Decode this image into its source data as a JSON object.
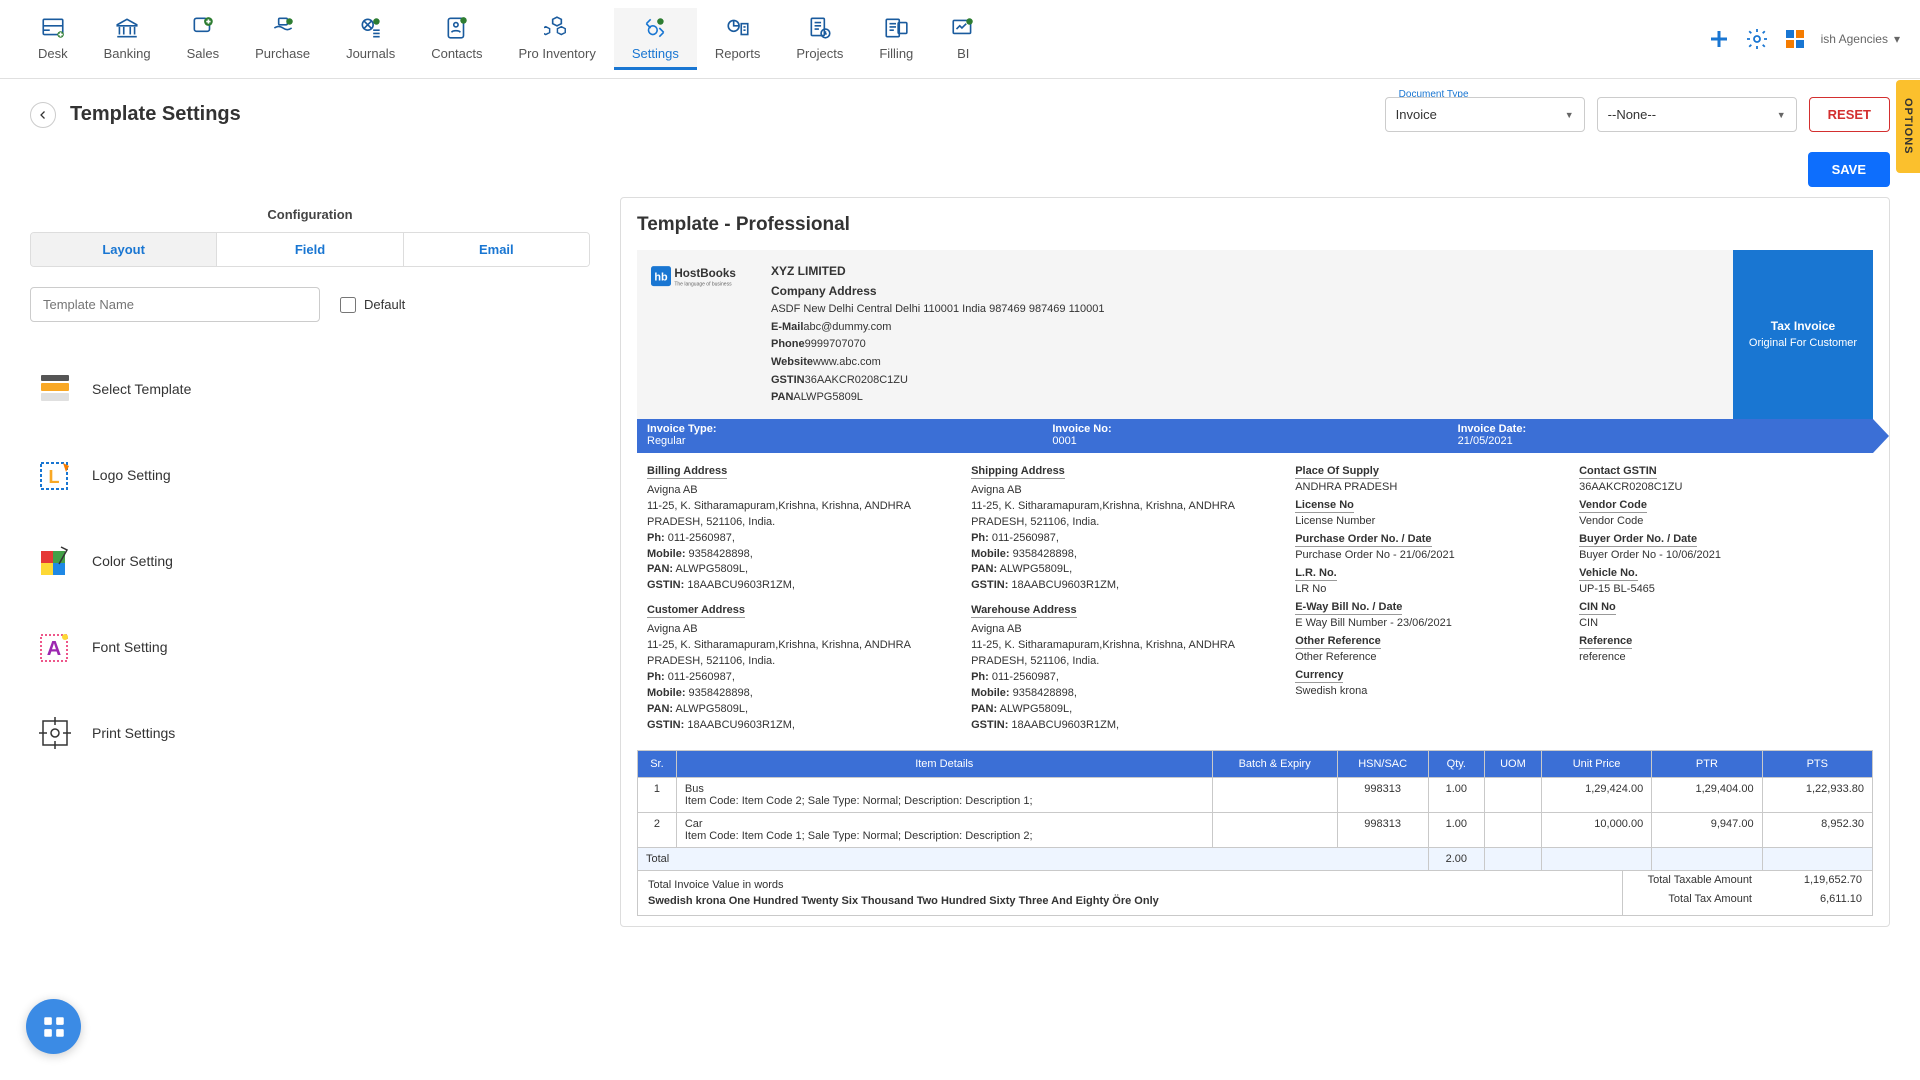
{
  "nav": {
    "items": [
      {
        "label": "Desk"
      },
      {
        "label": "Banking"
      },
      {
        "label": "Sales"
      },
      {
        "label": "Purchase"
      },
      {
        "label": "Journals"
      },
      {
        "label": "Contacts"
      },
      {
        "label": "Pro Inventory"
      },
      {
        "label": "Settings"
      },
      {
        "label": "Reports"
      },
      {
        "label": "Projects"
      },
      {
        "label": "Filling"
      },
      {
        "label": "BI"
      }
    ],
    "company": "ish Agencies"
  },
  "page": {
    "title": "Template Settings",
    "doc_type_label": "Document Type",
    "doc_type_value": "Invoice",
    "second_select_value": "--None--",
    "reset_label": "RESET",
    "options_label": "OPTIONS",
    "save_label": "SAVE"
  },
  "config": {
    "header": "Configuration",
    "tabs": [
      "Layout",
      "Field",
      "Email"
    ],
    "template_name_placeholder": "Template Name",
    "default_label": "Default",
    "menu": [
      "Select Template",
      "Logo Setting",
      "Color Setting",
      "Font Setting",
      "Print Settings"
    ]
  },
  "preview": {
    "title": "Template - Professional",
    "logo_text_main": "HostBooks",
    "logo_text_tag": "The language of business",
    "logo_badge": "hb",
    "company": {
      "name": "XYZ LIMITED",
      "addr_label": "Company Address",
      "addr": "ASDF New Delhi Central Delhi 110001 India 987469 987469 110001",
      "email_label": "E-Mail",
      "email": "abc@dummy.com",
      "phone_label": "Phone",
      "phone": "9999707070",
      "website_label": "Website",
      "website": "www.abc.com",
      "gstin_label": "GSTIN",
      "gstin": "36AAKCR0208C1ZU",
      "pan_label": "PAN",
      "pan": "ALWPG5809L"
    },
    "tax_box": {
      "line1": "Tax Invoice",
      "line2": "Original For Customer"
    },
    "strip": {
      "type_label": "Invoice Type:",
      "type_val": "Regular",
      "no_label": "Invoice No:",
      "no_val": "0001",
      "date_label": "Invoice Date:",
      "date_val": "21/05/2021"
    },
    "addr_titles": {
      "billing": "Billing Address",
      "shipping": "Shipping Address",
      "customer": "Customer Address",
      "warehouse": "Warehouse Address"
    },
    "addr_common": {
      "name": "Avigna AB",
      "street": "11-25, K. Sitharamapuram,Krishna, Krishna, ANDHRA PRADESH, 521106, India.",
      "ph_label": "Ph:",
      "ph": "011-2560987,",
      "mobile_label": "Mobile:",
      "mobile": "9358428898,",
      "pan_label": "PAN:",
      "pan": "ALWPG5809L,",
      "gstin_label": "GSTIN:",
      "gstin": "18AABCU9603R1ZM,"
    },
    "meta_fields": [
      {
        "lbl": "Place Of Supply",
        "val": "ANDHRA PRADESH"
      },
      {
        "lbl": "License No",
        "val": "License Number"
      },
      {
        "lbl": "Purchase Order No. / Date",
        "val": "Purchase Order No - 21/06/2021"
      },
      {
        "lbl": "L.R. No.",
        "val": "LR No"
      },
      {
        "lbl": "E-Way Bill No. / Date",
        "val": "E Way Bill Number - 23/06/2021"
      },
      {
        "lbl": "Other Reference",
        "val": "Other Reference"
      },
      {
        "lbl": "Currency",
        "val": "Swedish krona"
      }
    ],
    "meta_fields2": [
      {
        "lbl": "Contact GSTIN",
        "val": "36AAKCR0208C1ZU"
      },
      {
        "lbl": "Vendor Code",
        "val": "Vendor Code"
      },
      {
        "lbl": "Buyer Order No. / Date",
        "val": "Buyer Order No - 10/06/2021"
      },
      {
        "lbl": "Vehicle No.",
        "val": "UP-15 BL-5465"
      },
      {
        "lbl": "CIN No",
        "val": "CIN"
      },
      {
        "lbl": "Reference",
        "val": "reference"
      }
    ],
    "table": {
      "headers": [
        "Sr.",
        "Item Details",
        "Batch & Expiry",
        "HSN/SAC",
        "Qty.",
        "UOM",
        "Unit Price",
        "PTR",
        "PTS"
      ],
      "rows": [
        {
          "sr": "1",
          "name": "Bus",
          "desc": "Item Code: Item Code 2; Sale Type: Normal; Description: Description 1;",
          "batch": "",
          "hsn": "998313",
          "qty": "1.00",
          "uom": "",
          "price": "1,29,424.00",
          "ptr": "1,29,404.00",
          "pts": "1,22,933.80"
        },
        {
          "sr": "2",
          "name": "Car",
          "desc": "Item Code: Item Code 1; Sale Type: Normal; Description: Description 2;",
          "batch": "",
          "hsn": "998313",
          "qty": "1.00",
          "uom": "",
          "price": "10,000.00",
          "ptr": "9,947.00",
          "pts": "8,952.30"
        }
      ],
      "total_label": "Total",
      "total_qty": "2.00"
    },
    "words": {
      "label": "Total Invoice Value in words",
      "value": "Swedish krona One Hundred Twenty Six Thousand Two Hundred Sixty Three And Eighty Öre Only"
    },
    "totals": [
      {
        "lbl": "Total Taxable Amount",
        "val": "1,19,652.70"
      },
      {
        "lbl": "Total Tax Amount",
        "val": "6,611.10"
      }
    ]
  }
}
